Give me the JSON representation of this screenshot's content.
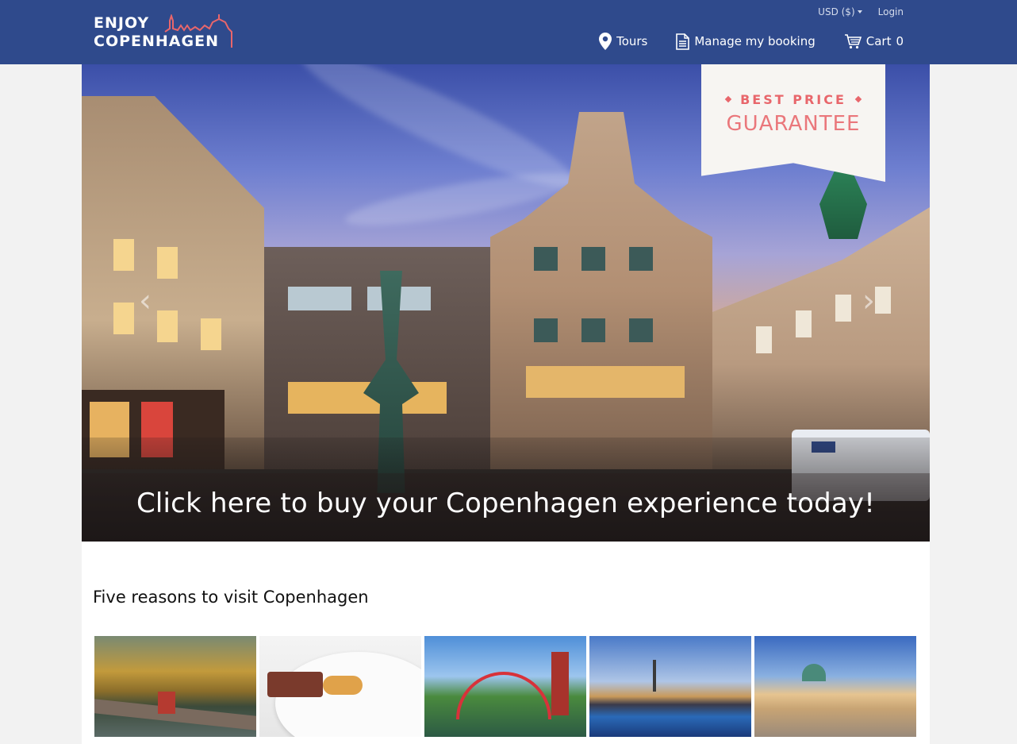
{
  "brand": {
    "line1": "ENJOY",
    "line2": "COPENHAGEN",
    "accent": "#e8666b",
    "header_bg": "#2f4a8c"
  },
  "topbar": {
    "currency": "USD ($)",
    "login": "Login"
  },
  "nav": [
    {
      "icon": "map-marker-icon",
      "label": "Tours"
    },
    {
      "icon": "document-icon",
      "label": "Manage my booking"
    },
    {
      "icon": "cart-icon",
      "label": "Cart",
      "count": "0"
    }
  ],
  "hero": {
    "caption": "Click here to buy your Copenhagen experience today!",
    "badge_top": "BEST PRICE",
    "badge_bottom": "GUARANTEE"
  },
  "section": {
    "title": "Five reasons to visit Copenhagen"
  }
}
